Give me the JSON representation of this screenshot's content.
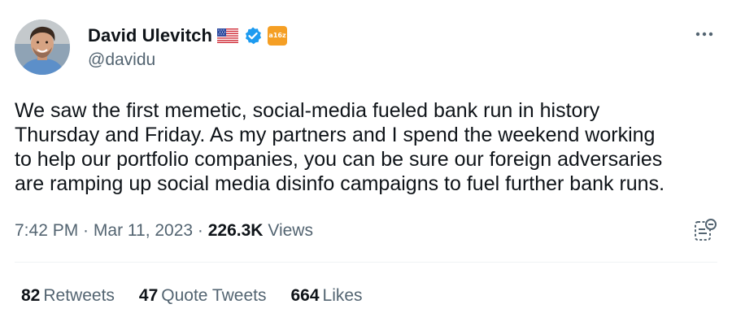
{
  "author": {
    "name": "David Ulevitch",
    "handle": "@davidu",
    "badges": [
      "us-flag-icon",
      "verified-icon",
      "a16z-badge-icon"
    ],
    "org_badge_text": "a16z"
  },
  "tweet": {
    "text": "We saw the first memetic, social-media fueled bank run in history\nThursday and Friday. As my partners and I spend the weekend working\nto help our portfolio companies, you can be sure our foreign adversaries\nare ramping up social media disinfo campaigns to fuel further bank runs."
  },
  "meta": {
    "time": "7:42 PM",
    "separator": " · ",
    "date": "Mar 11, 2023",
    "views_count": "226.3K",
    "views_label": "Views"
  },
  "stats": {
    "retweets_count": "82",
    "retweets_label": "Retweets",
    "quotes_count": "47",
    "quotes_label": "Quote Tweets",
    "likes_count": "664",
    "likes_label": "Likes"
  },
  "colors": {
    "text_primary": "#0f1419",
    "text_secondary": "#536471",
    "verified_blue": "#1d9bf0",
    "org_badge": "#f59f24",
    "divider": "#eff3f4"
  }
}
